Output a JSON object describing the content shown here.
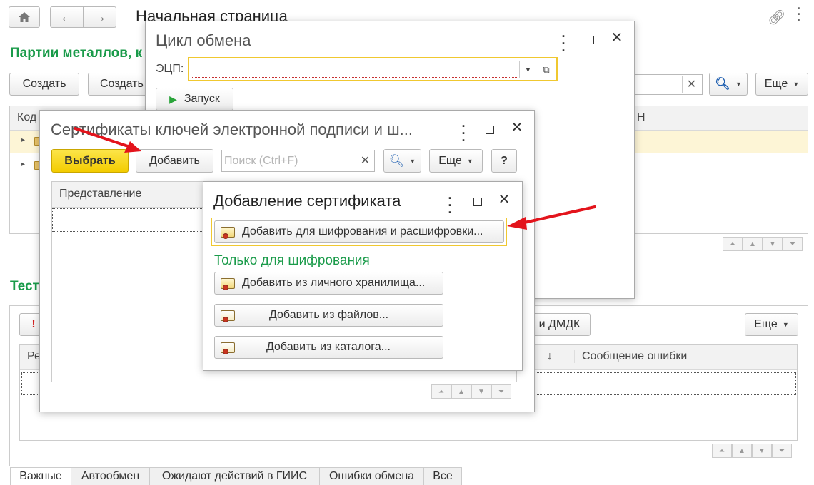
{
  "top_bar": {
    "home_icon": "home-icon",
    "back_icon": "arrow-left-icon",
    "forward_icon": "arrow-right-icon",
    "page_title": "Начальная страница",
    "link_icon": "link-icon"
  },
  "background": {
    "section1_title": "Партии металлов, к",
    "toolbar": {
      "create": "Создать",
      "create2": "Создать",
      "more": "Еще"
    },
    "grid": {
      "col_code": "Код",
      "col_right": "Н"
    },
    "section2_title": "Тест",
    "section2": {
      "dmdk_button": "и ДМДК",
      "more": "Еще",
      "col_sort": "↓",
      "col_error": "Сообщение ошибки",
      "col_left": "Ре"
    },
    "tabs": [
      "Важные",
      "Автообмен",
      "Ожидают действий в ГИИС",
      "Ошибки обмена",
      "Все"
    ]
  },
  "exchange_window": {
    "title": "Цикл обмена",
    "ecp_label": "ЭЦП:",
    "ecp_value": "",
    "start_button": "Запуск"
  },
  "certificates_window": {
    "title": "Сертификаты ключей электронной подписи и ш...",
    "select_button": "Выбрать",
    "add_button": "Добавить",
    "search_placeholder": "Поиск (Ctrl+F)",
    "more_button": "Еще",
    "help_button": "?",
    "col_representation": "Представление"
  },
  "add_cert_window": {
    "title": "Добавление сертификата",
    "btn_encrypt_decrypt": "Добавить для шифрования и расшифровки...",
    "section_encrypt_only": "Только для шифрования",
    "btn_personal_store": "Добавить из личного хранилища...",
    "btn_from_files": "Добавить из файлов...",
    "btn_from_catalog": "Добавить из каталога..."
  },
  "colors": {
    "accent_green": "#1a9b4a",
    "select_yellow": "#f5d400",
    "arrow_red": "#e3141c",
    "highlight_row": "#fdf5d6"
  }
}
